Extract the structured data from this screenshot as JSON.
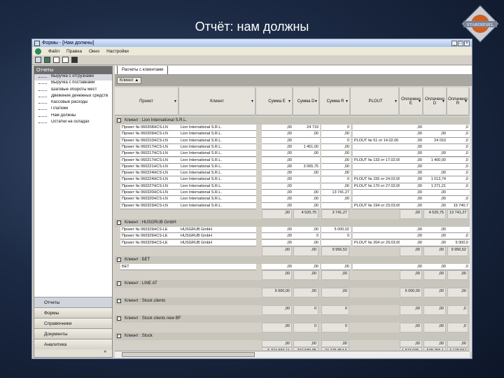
{
  "slide": {
    "title": "Отчёт: нам должны",
    "logo_text": "STARDIESEL"
  },
  "window": {
    "title": "Формы - [Нам должны]",
    "menu": [
      "Файл",
      "Правка",
      "Окно",
      "Настройки"
    ]
  },
  "left": {
    "header": "Отчеты",
    "tree": [
      "Выручка с отгрузками",
      "Выручка с поставками",
      "Шаговые обороты мест",
      "Движение денежных средств",
      "Кассовые расходы",
      "Платежи",
      "Нам должны",
      "Остатки на складах"
    ],
    "nav": [
      "Отчеты",
      "Формы",
      "Справочники",
      "Документы",
      "Аналитика"
    ]
  },
  "grid": {
    "tab": "Расчеты с клиентами",
    "group_chip": "Клиент ▲",
    "columns": [
      "Проект",
      "Клиент",
      "Сумма E",
      "Сумма D",
      "Сумма R",
      "PLOUT",
      "Оплачено E",
      "Оплачено D",
      "Оплачено R"
    ],
    "groups": [
      {
        "label": "Клиент : Lion International S.R.L.",
        "rows": [
          [
            "Проект № 060208HCS-LN",
            "Lion International S.R.L.",
            ",00",
            "24 719",
            "0",
            "",
            ",00",
            "",
            ",0"
          ],
          [
            "Проект № 060209HCS-LN",
            "Lion International S.R.L.",
            ",00",
            ",00",
            ",00",
            "",
            ",00",
            ",00",
            ",0"
          ],
          [
            "Проект № 060210HCS-LN",
            "Lion International S.R.L.",
            ",00",
            "",
            "0",
            "PLOUT № 51 от 14.02.06",
            ",00",
            "24 010",
            ",0"
          ],
          [
            "Проект № 060217HCS-LN",
            "Lion International S.R.L.",
            ",00",
            "1 451,00",
            ",00",
            "",
            ",00",
            "",
            ",0"
          ],
          [
            "Проект № 060217HCS-LN",
            "Lion International S.R.L.",
            ",00",
            ",00",
            ",00",
            "",
            ",00",
            ",00",
            ",0"
          ],
          [
            "Проект № 060217HCS-LN",
            "Lion International S.R.L.",
            ",00",
            "",
            ",00",
            "PLOUT № 133 от 17.02.06",
            ",00",
            "1 400,00",
            ",0"
          ],
          [
            "Проект № 060221HCS-LN",
            "Lion International S.R.L.",
            ",00",
            "3 065,75",
            ",00",
            "",
            ",00",
            "",
            ",0"
          ],
          [
            "Проект № 060224HCS-LN",
            "Lion International S.R.L.",
            ",00",
            ",00",
            ",00",
            "",
            ",00",
            ",00",
            ",0"
          ],
          [
            "Проект № 060224HCS-LN",
            "Lion International S.R.L.",
            ",00",
            "",
            "0",
            "PLOUT № 155 от 24.02.06",
            ",00",
            "1 013,74",
            ",0"
          ],
          [
            "Проект № 060227HCS-LN",
            "Lion International S.R.L.",
            ",00",
            "",
            ",00",
            "PLOUT № 170 от 27.02.06",
            ",00",
            "1 271,21",
            ",0"
          ],
          [
            "Проект № 060320HCS-LN",
            "Lion International S.R.L.",
            ",00",
            ",00",
            "13 741,27",
            "",
            ",00",
            ",00",
            ""
          ],
          [
            "Проект № 060320HCS-LN",
            "Lion International S.R.L.",
            ",00",
            ",00",
            ",00",
            "",
            ",00",
            ",00",
            ",0"
          ],
          [
            "Проект № 060323HCS-LN",
            "Lion International S.R.L.",
            ",00",
            ",00",
            "",
            "PLOUT № 194 от 23.03.06",
            ",00",
            ",00",
            "19 740,7"
          ]
        ],
        "totals": [
          ",00",
          "4 520,75",
          "3 741,27",
          ",00",
          "4 520,75",
          "13 741,27"
        ]
      },
      {
        "label": "Клиент : HUSGRUB GmbH",
        "rows": [
          [
            "Проект № 060329HCS-LE",
            "HUSGRUB GmbH",
            ",00",
            ",00",
            "5 000,02",
            "",
            ",00",
            ",00",
            ""
          ],
          [
            "Проект № 060329HCS-LE",
            "HUSGRUB GmbH",
            ",00",
            "0",
            "0",
            "",
            ",00",
            ",00",
            ",0"
          ],
          [
            "Проект № 060329HCS-LE",
            "HUSGRUB GmbH",
            ",00",
            ",00",
            "",
            "PLOUT № 204 от 29.03.06",
            ",00",
            ",00",
            "5 000,0"
          ]
        ],
        "totals": [
          ",00",
          ",00",
          "9 956,52",
          ",00",
          ",00",
          "9 956,52"
        ]
      },
      {
        "label": "Клиент : БЕТ",
        "rows": [
          [
            "БЕТ",
            "",
            ",00",
            ",00",
            ",00",
            "",
            ",00",
            ",00",
            ",0"
          ]
        ],
        "totals": [
          ",00",
          ",00",
          ",00",
          ",00",
          ",00",
          ",00"
        ]
      },
      {
        "label": "Клиент : LINE AT",
        "rows": [],
        "totals": [
          "5 000,00",
          ",00",
          ",00",
          "5 000,00",
          ",00",
          ",00"
        ]
      },
      {
        "label": "Клиент : Stock clients",
        "rows": [],
        "totals": [
          ",00",
          "0",
          "0",
          ",00",
          ",00",
          ",0"
        ]
      },
      {
        "label": "Клиент : Stock clients new BF",
        "rows": [],
        "totals": [
          ",00",
          "0",
          "0",
          ",00",
          ",00",
          ",0"
        ]
      },
      {
        "label": "Клиент : Stock",
        "rows": [],
        "totals": [
          ",00",
          ",00",
          ",00",
          ",00",
          ",00",
          ",00"
        ]
      }
    ],
    "grand_totals": [
      "5 324 556,11",
      "207 580,85",
      "24 276 854,5",
      "1 573 005,",
      "538 755,1",
      "3 178 557,"
    ]
  }
}
